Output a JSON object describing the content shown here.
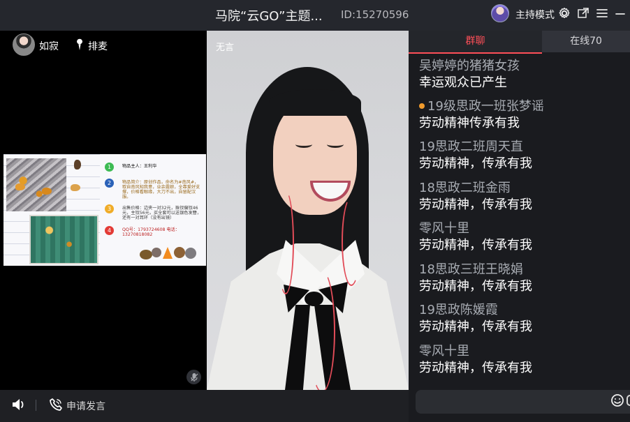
{
  "header": {
    "title": "马院“云GO”主题...",
    "id_text": "ID:15270596",
    "host_mode_label": "主持模式"
  },
  "left_panel": {
    "user_name": "如寂",
    "queue_label": "排麦"
  },
  "slide": {
    "items": [
      {
        "num": "1",
        "text": "物品主人：王利华",
        "color": "#3dbb53"
      },
      {
        "num": "2",
        "text": "物品简介：原创作品，命名为#南风#，取自南风知我意，业余露娘，全靠爱好支撑，价格看眼缘，大刀不出，自留配汉服。",
        "color": "#2b62b8"
      },
      {
        "num": "3",
        "text": "出售价格：边夹一对32元，珠钗偏钗46元，主钗56元，买全套可以送银色发簪，还有一对耳环（没有出镜）",
        "color": "#f0ac28"
      },
      {
        "num": "4",
        "text": "QQ号：1793724608 电话：13270818082",
        "color": "#e33b36"
      }
    ]
  },
  "stage": {
    "label": "无言"
  },
  "footer": {
    "apply_label": "申请发言"
  },
  "chat": {
    "tabs": [
      {
        "label": "群聊",
        "active": true
      },
      {
        "label": "在线70",
        "active": false
      }
    ],
    "messages": [
      {
        "name": "吴婷婷的猪猪女孩",
        "text": "幸运观众已产生",
        "badge": false
      },
      {
        "name": "19级思政一班张梦谣",
        "text": "劳动精神传承有我",
        "badge": true
      },
      {
        "name": "19思政二班周天直",
        "text": "劳动精神，传承有我",
        "badge": false
      },
      {
        "name": "18思政二班金雨",
        "text": "劳动精神，传承有我",
        "badge": false
      },
      {
        "name": "零风十里",
        "text": "劳动精神，传承有我",
        "badge": false
      },
      {
        "name": "18思政三班王晓娟",
        "text": "劳动精神，传承有我",
        "badge": false
      },
      {
        "name": "19思政陈媛霞",
        "text": "劳动精神，传承有我",
        "badge": false
      },
      {
        "name": "零风十里",
        "text": "劳动精神，传承有我",
        "badge": false
      }
    ]
  },
  "colors": {
    "accent": "#ff4f58",
    "panel": "#1a1b1f",
    "titlebar": "#25272d"
  },
  "icons": [
    "settings-icon",
    "share-icon",
    "menu-icon",
    "minimize-icon",
    "microphone-icon",
    "speaker-icon",
    "phone-icon",
    "emoji-icon"
  ]
}
